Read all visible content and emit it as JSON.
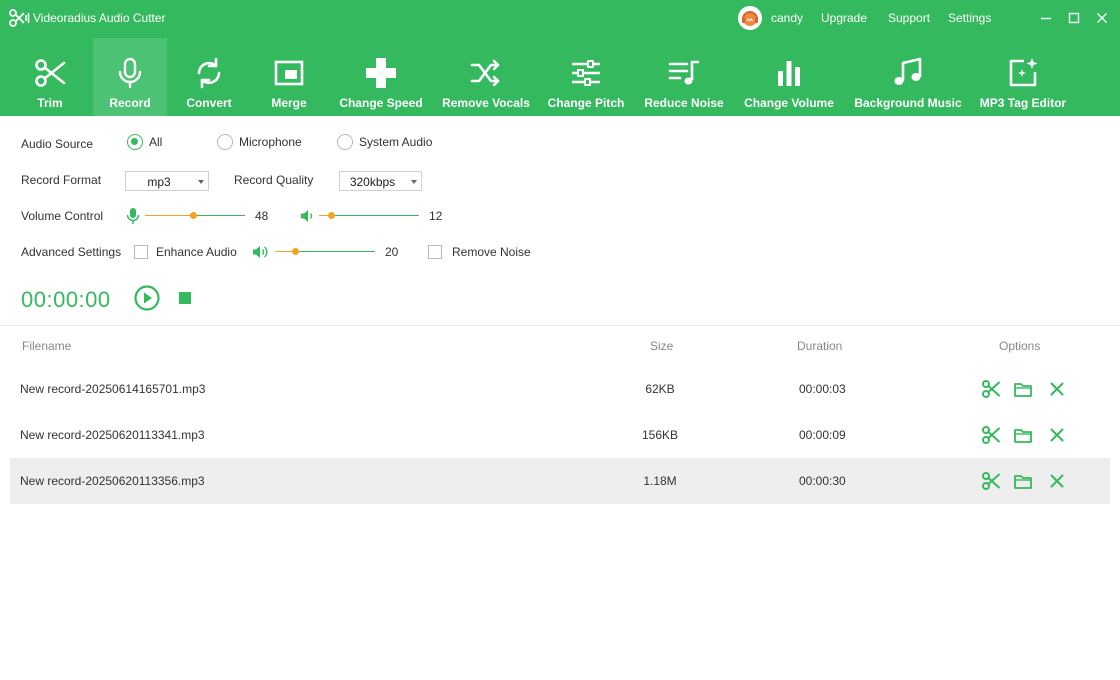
{
  "app": {
    "title": "Videoradius Audio Cutter"
  },
  "user": {
    "name": "candy"
  },
  "menu": {
    "upgrade": "Upgrade",
    "support": "Support",
    "settings": "Settings"
  },
  "toolbar": [
    {
      "label": "Trim",
      "icon": "scissors-icon"
    },
    {
      "label": "Record",
      "icon": "microphone-icon",
      "active": true
    },
    {
      "label": "Convert",
      "icon": "convert-icon"
    },
    {
      "label": "Merge",
      "icon": "merge-icon"
    },
    {
      "label": "Change Speed",
      "icon": "speed-icon"
    },
    {
      "label": "Remove Vocals",
      "icon": "shuffle-icon"
    },
    {
      "label": "Change Pitch",
      "icon": "sliders-icon"
    },
    {
      "label": "Reduce Noise",
      "icon": "noise-icon"
    },
    {
      "label": "Change Volume",
      "icon": "bar-chart-icon"
    },
    {
      "label": "Background Music",
      "icon": "music-note-icon"
    },
    {
      "label": "MP3 Tag Editor",
      "icon": "tag-edit-icon"
    }
  ],
  "settings": {
    "audio_source_label": "Audio Source",
    "source_options": [
      "All",
      "Microphone",
      "System Audio"
    ],
    "source_selected": "All",
    "record_format_label": "Record Format",
    "record_format": "mp3",
    "record_quality_label": "Record Quality",
    "record_quality": "320kbps",
    "volume_control_label": "Volume Control",
    "mic_volume": 48,
    "system_volume": 12,
    "advanced_label": "Advanced Settings",
    "enhance_label": "Enhance Audio",
    "enhance_checked": false,
    "enhance_value": 20,
    "remove_noise_label": "Remove Noise",
    "remove_noise_checked": false,
    "timer": "00:00:00"
  },
  "table": {
    "headers": {
      "filename": "Filename",
      "size": "Size",
      "duration": "Duration",
      "options": "Options"
    },
    "rows": [
      {
        "filename": "New record-20250614165701.mp3",
        "size": "62KB",
        "duration": "00:00:03"
      },
      {
        "filename": "New record-20250620113341.mp3",
        "size": "156KB",
        "duration": "00:00:09"
      },
      {
        "filename": "New record-20250620113356.mp3",
        "size": "1.18M",
        "duration": "00:00:30",
        "selected": true
      }
    ]
  },
  "colors": {
    "accent": "#34b95f",
    "slider_knob": "#f4a224",
    "active_tab": "#4cc274"
  }
}
